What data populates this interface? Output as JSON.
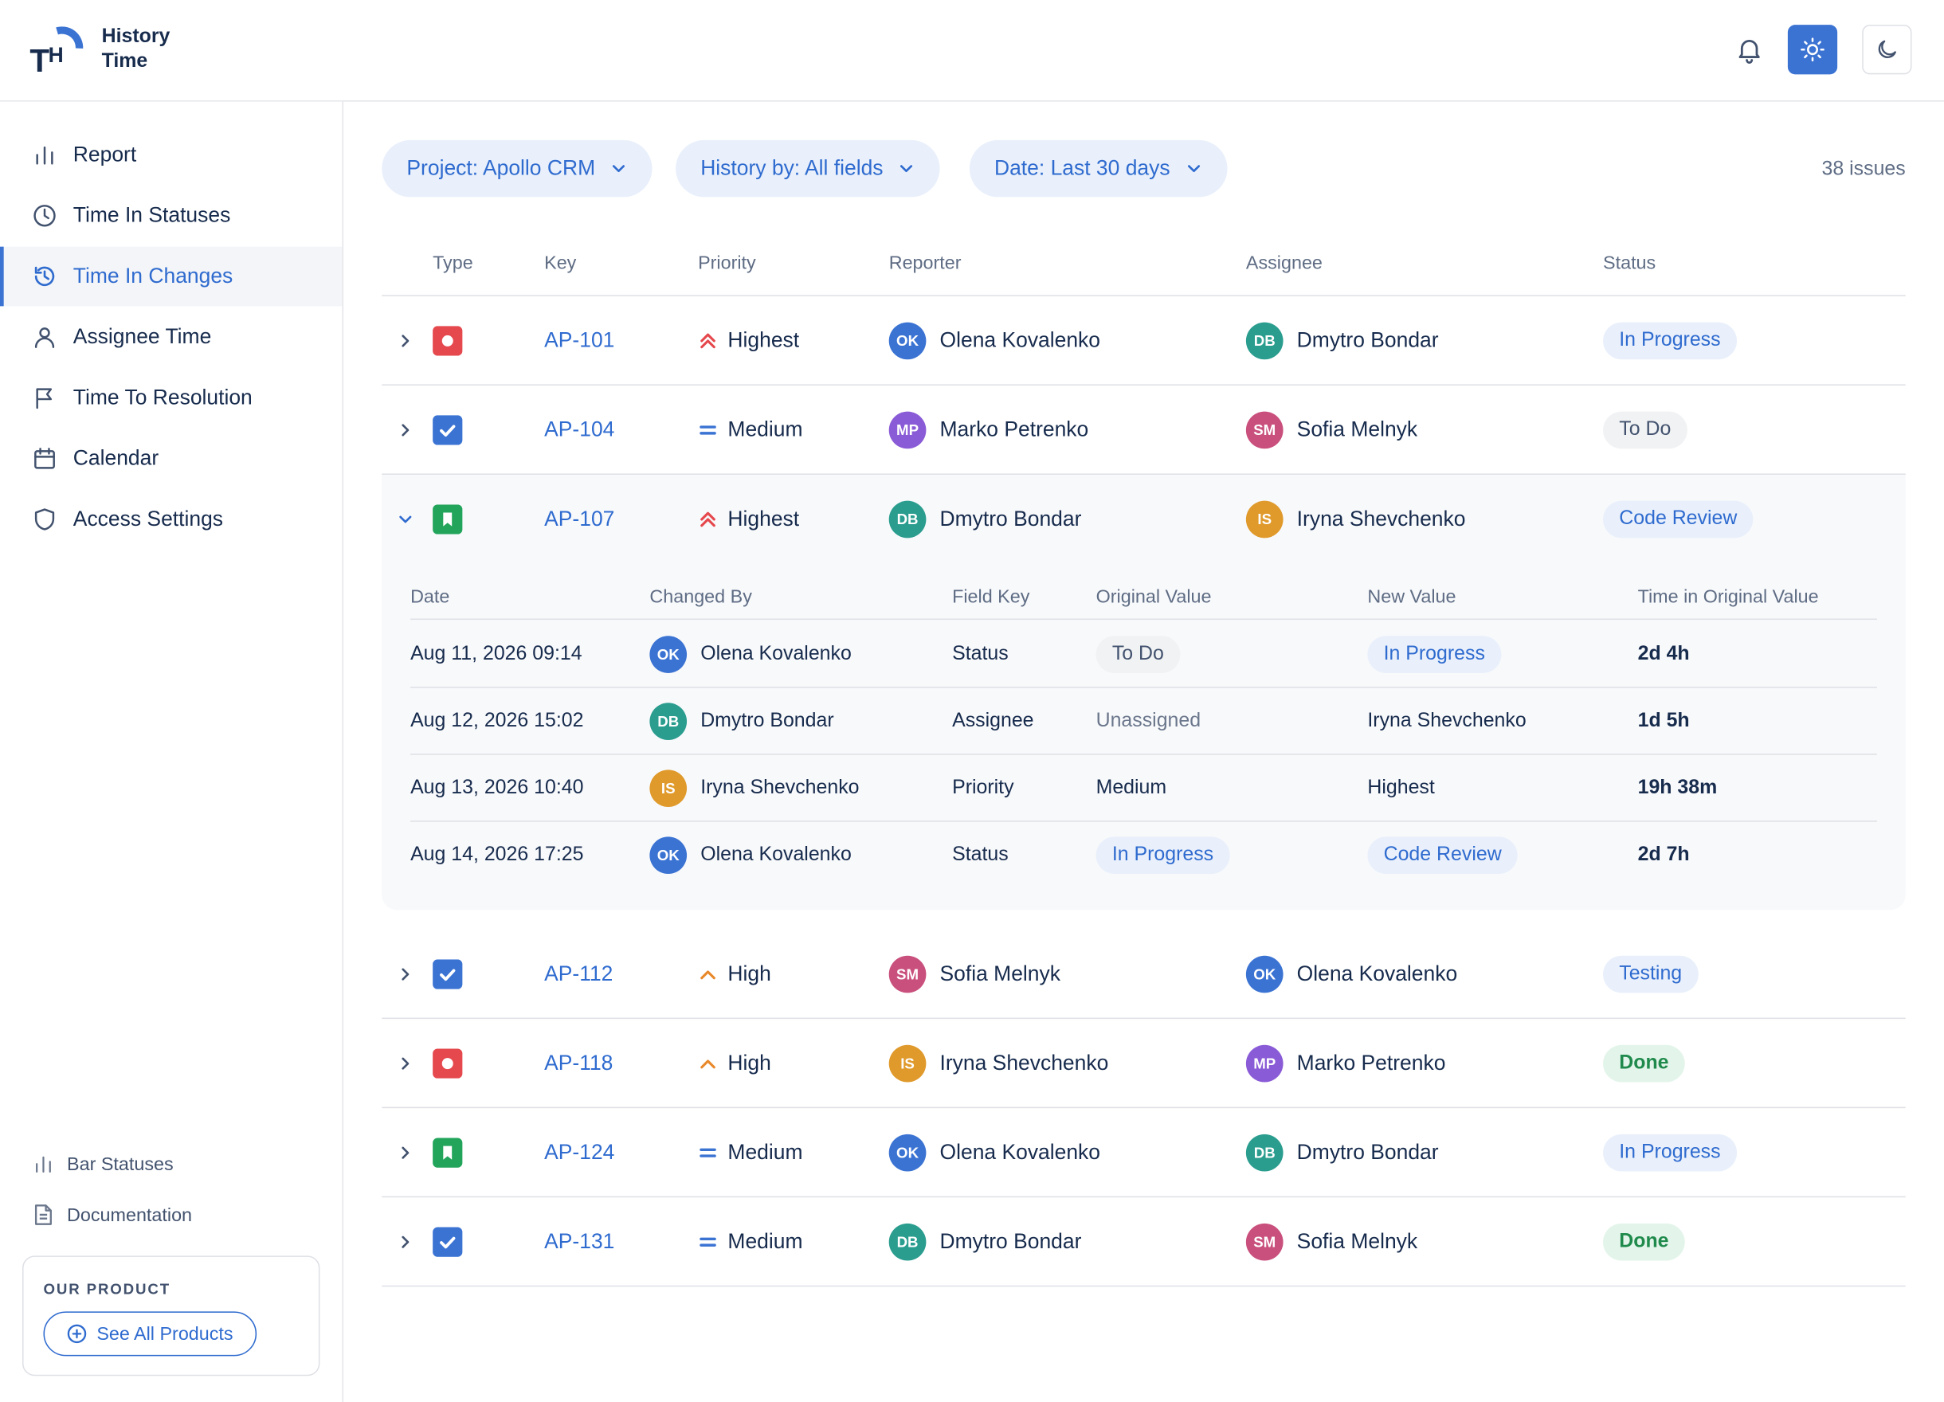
{
  "brand": {
    "line1": "History",
    "line2": "Time"
  },
  "colors": {
    "accent": "#3b73d3",
    "link": "#2f6bcf",
    "border": "#dfe1e6"
  },
  "sidebar": {
    "items": [
      {
        "label": "Report",
        "icon": "bar-chart-icon"
      },
      {
        "label": "Time In Statuses",
        "icon": "clock-icon"
      },
      {
        "label": "Time In Changes",
        "icon": "history-icon",
        "active": true
      },
      {
        "label": "Assignee Time",
        "icon": "user-icon"
      },
      {
        "label": "Time To Resolution",
        "icon": "flag-icon"
      },
      {
        "label": "Calendar",
        "icon": "calendar-icon"
      },
      {
        "label": "Access Settings",
        "icon": "shield-icon"
      }
    ],
    "bottom": [
      {
        "label": "Bar Statuses",
        "icon": "bar-chart-icon"
      },
      {
        "label": "Documentation",
        "icon": "document-icon"
      }
    ],
    "product": {
      "label": "OUR PRODUCT",
      "button": "See All Products"
    }
  },
  "filters": {
    "project": "Project: Apollo CRM",
    "history": "History by: All fields",
    "date": "Date: Last 30 days"
  },
  "issues_count": "38 issues",
  "table": {
    "columns": [
      "Type",
      "Key",
      "Priority",
      "Reporter",
      "Assignee",
      "Status"
    ],
    "rows": [
      {
        "key": "AP-101",
        "type": "bug",
        "priority": "Highest",
        "reporter": {
          "initials": "OK",
          "name": "Olena Kovalenko"
        },
        "assignee": {
          "initials": "DB",
          "name": "Dmytro Bondar"
        },
        "status": "In Progress"
      },
      {
        "key": "AP-104",
        "type": "task",
        "priority": "Medium",
        "reporter": {
          "initials": "MP",
          "name": "Marko Petrenko"
        },
        "assignee": {
          "initials": "SM",
          "name": "Sofia Melnyk"
        },
        "status": "To Do"
      },
      {
        "key": "AP-107",
        "type": "story",
        "priority": "Highest",
        "reporter": {
          "initials": "DB",
          "name": "Dmytro Bondar"
        },
        "assignee": {
          "initials": "IS",
          "name": "Iryna Shevchenko"
        },
        "status": "Code Review"
      },
      {
        "key": "AP-112",
        "type": "task",
        "priority": "High",
        "reporter": {
          "initials": "SM",
          "name": "Sofia Melnyk"
        },
        "assignee": {
          "initials": "OK",
          "name": "Olena Kovalenko"
        },
        "status": "Testing"
      },
      {
        "key": "AP-118",
        "type": "bug",
        "priority": "High",
        "reporter": {
          "initials": "IS",
          "name": "Iryna Shevchenko"
        },
        "assignee": {
          "initials": "MP",
          "name": "Marko Petrenko"
        },
        "status": "Done"
      },
      {
        "key": "AP-124",
        "type": "story",
        "priority": "Medium",
        "reporter": {
          "initials": "OK",
          "name": "Olena Kovalenko"
        },
        "assignee": {
          "initials": "DB",
          "name": "Dmytro Bondar"
        },
        "status": "In Progress"
      },
      {
        "key": "AP-131",
        "type": "task",
        "priority": "Medium",
        "reporter": {
          "initials": "DB",
          "name": "Dmytro Bondar"
        },
        "assignee": {
          "initials": "SM",
          "name": "Sofia Melnyk"
        },
        "status": "Done"
      }
    ]
  },
  "history": {
    "columns": [
      "Date",
      "Changed By",
      "Field Key",
      "Original Value",
      "New Value",
      "Time in Original Value"
    ],
    "rows": [
      {
        "date": "Aug 11, 2026 09:14",
        "by": {
          "initials": "OK",
          "name": "Olena Kovalenko"
        },
        "field": "Status",
        "original": "To Do",
        "new": "In Progress",
        "time": "2d 4h"
      },
      {
        "date": "Aug 12, 2026 15:02",
        "by": {
          "initials": "DB",
          "name": "Dmytro Bondar"
        },
        "field": "Assignee",
        "original": "Unassigned",
        "new": "Iryna Shevchenko",
        "time": "1d 5h"
      },
      {
        "date": "Aug 13, 2026 10:40",
        "by": {
          "initials": "IS",
          "name": "Iryna Shevchenko"
        },
        "field": "Priority",
        "original": "Medium",
        "new": "Highest",
        "time": "19h 38m"
      },
      {
        "date": "Aug 14, 2026 17:25",
        "by": {
          "initials": "OK",
          "name": "Olena Kovalenko"
        },
        "field": "Status",
        "original": "In Progress",
        "new": "Code Review",
        "time": "2d 7h"
      }
    ]
  }
}
